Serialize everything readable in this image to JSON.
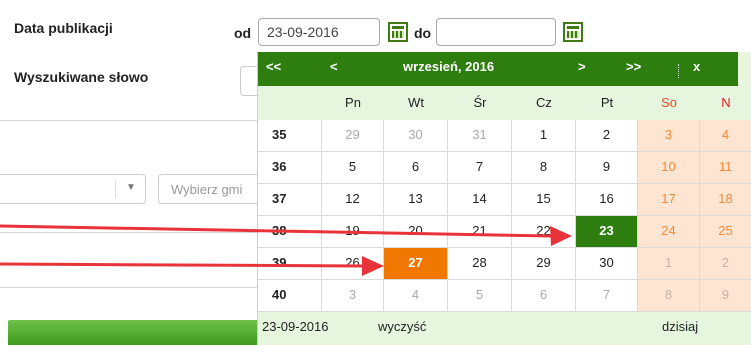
{
  "form": {
    "date_label": "Data publikacji",
    "from_label": "od",
    "from_value": "23-09-2016",
    "to_label": "do",
    "to_value": "",
    "keyword_label": "Wyszukiwane słowo",
    "select_arrow": "▼",
    "gmina_placeholder": "Wybierz gmi"
  },
  "calendar": {
    "nav_first": "<<",
    "nav_prev": "<",
    "month_title": "wrzesień, 2016",
    "nav_next": ">",
    "nav_last": ">>",
    "close": "x",
    "weekdays": [
      "Pn",
      "Wt",
      "Śr",
      "Cz",
      "Pt",
      "So",
      "N"
    ],
    "weeks": [
      {
        "week": "35",
        "days": [
          "29",
          "30",
          "31",
          "1",
          "2",
          "3",
          "4"
        ]
      },
      {
        "week": "36",
        "days": [
          "5",
          "6",
          "7",
          "8",
          "9",
          "10",
          "11"
        ]
      },
      {
        "week": "37",
        "days": [
          "12",
          "13",
          "14",
          "15",
          "16",
          "17",
          "18"
        ]
      },
      {
        "week": "38",
        "days": [
          "19",
          "20",
          "21",
          "22",
          "23",
          "24",
          "25"
        ]
      },
      {
        "week": "39",
        "days": [
          "26",
          "27",
          "28",
          "29",
          "30",
          "1",
          "2"
        ]
      },
      {
        "week": "40",
        "days": [
          "3",
          "4",
          "5",
          "6",
          "7",
          "8",
          "9"
        ]
      }
    ],
    "selected_day": "23",
    "today_day": "27",
    "footer_date": "23-09-2016",
    "clear_label": "wyczyść",
    "today_label": "dzisiaj"
  },
  "colors": {
    "header_green": "#2e7d0f",
    "selected_green": "#2e7d0f",
    "today_orange": "#f07800",
    "annotation_red": "#e8333b",
    "weekend_bg": "#fde5d2"
  }
}
